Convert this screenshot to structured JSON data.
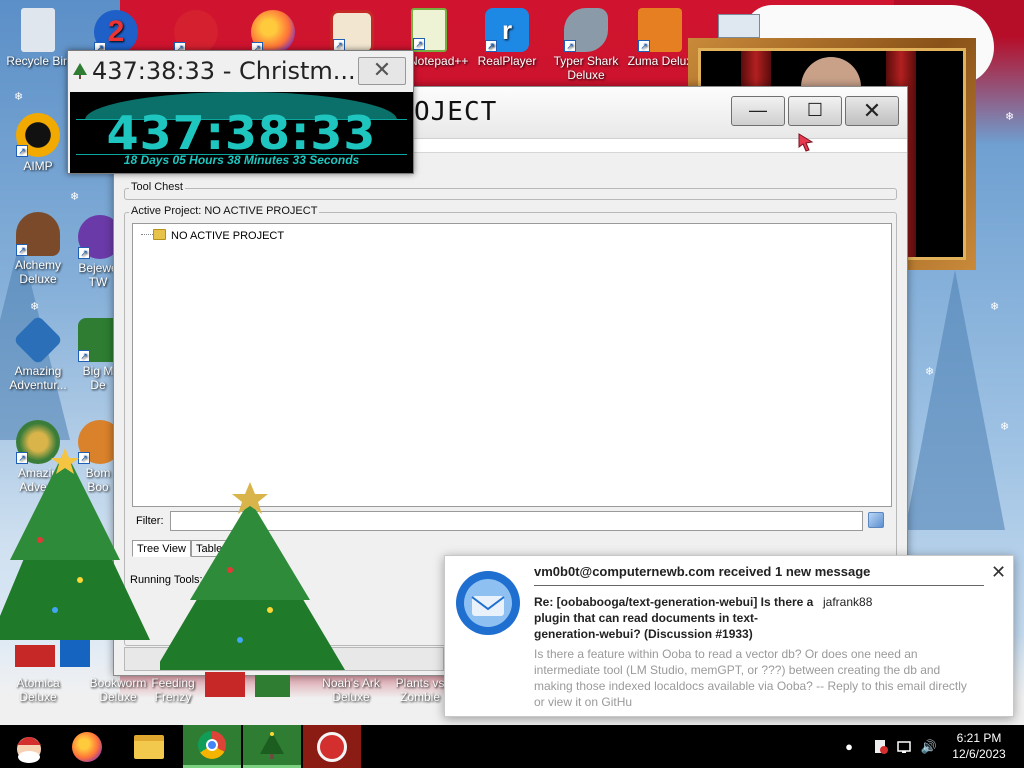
{
  "desktop": {
    "icons": [
      {
        "label": "Recycle Bin",
        "icon": "recycle-bin-icon",
        "color": "#dfe6ee"
      },
      {
        "label": "AIMP",
        "icon": "aimp-icon",
        "color": "#f2a900"
      },
      {
        "label": "Alchemy Deluxe",
        "icon": "alchemy-icon",
        "color": "#7b4a2a"
      },
      {
        "label": "Amazing Adventur...",
        "icon": "amazing-adventures-icon",
        "color": "#2a6fb8"
      },
      {
        "label": "Amazin Advent",
        "icon": "amazing-adventures-2-icon",
        "color": "#3a7d3a"
      },
      {
        "label": "Atomica Deluxe",
        "icon": "atomica-icon",
        "color": "#aa3355"
      },
      {
        "label": "Bejewe TW",
        "icon": "bejeweled-icon",
        "color": "#6a3aa8"
      },
      {
        "label": "Big M De",
        "icon": "big-money-icon",
        "color": "#2e7d32"
      },
      {
        "label": "Bom Boo",
        "icon": "bomboozle-icon",
        "color": "#d9822b"
      },
      {
        "label": "Bookworm Deluxe",
        "icon": "bookworm-icon",
        "color": "#2e8b57"
      },
      {
        "label": "Feeding Frenzy",
        "icon": "feeding-frenzy-icon",
        "color": "#1e88e5"
      },
      {
        "label": "Noah's Ark Deluxe",
        "icon": "noahs-ark-icon",
        "color": "#8d6e63"
      },
      {
        "label": "Plants vs Zombie",
        "icon": "plants-vs-zombies-icon",
        "color": "#7cb342"
      },
      {
        "label": "Notepad++",
        "icon": "notepad-plus-plus-icon",
        "color": "#76b041"
      },
      {
        "label": "RealPlayer",
        "icon": "realplayer-icon",
        "color": "#1e88e5"
      },
      {
        "label": "Typer Shark Deluxe",
        "icon": "typer-shark-icon",
        "color": "#6c7a89"
      },
      {
        "label": "Zuma Delux",
        "icon": "zuma-icon",
        "color": "#e67e22"
      }
    ]
  },
  "main_window": {
    "title": "OJECT",
    "minimize": "—",
    "maximize": "☐",
    "close": "✕",
    "tool_chest_label": "Tool Chest",
    "active_project_label": "Active Project: NO ACTIVE PROJECT",
    "tree_node": "NO ACTIVE PROJECT",
    "filter_label": "Filter:",
    "filter_value": "",
    "tabs": [
      "Tree View",
      "Table"
    ],
    "running_tools_label": "Running Tools:"
  },
  "countdown": {
    "title": "437:38:33 - Christm...",
    "close": "✕",
    "big_time": "437:38:33",
    "detail": "18 Days 05 Hours 38 Minutes 33 Seconds",
    "color": "#1fc6c0"
  },
  "notification": {
    "header": "vm0b0t@computernewb.com received 1 new message",
    "close": "✕",
    "subject": "Re: [oobabooga/text-generation-webui] Is there a plugin that can read documents in text-generation-webui? (Discussion #1933)",
    "from": "jafrank88",
    "body": "Is there a feature within Ooba to read a vector db? Or does one need an intermediate tool (LM Studio, memGPT, or ???) between creating the db and making those indexed localdocs available via Ooba? -- Reply to this email directly or view it on GitHu"
  },
  "taskbar": {
    "items": [
      {
        "name": "santa-start",
        "icon": "santa-icon"
      },
      {
        "name": "firefox",
        "icon": "firefox-icon"
      },
      {
        "name": "file-explorer",
        "icon": "folder-icon"
      },
      {
        "name": "chrome",
        "icon": "chrome-icon"
      },
      {
        "name": "xmas-countdown",
        "icon": "christmas-tree-icon"
      },
      {
        "name": "app-red",
        "icon": "red-app-icon"
      }
    ],
    "time": "6:21 PM",
    "date": "12/6/2023"
  }
}
